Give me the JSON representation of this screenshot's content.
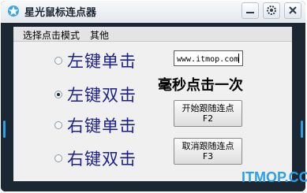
{
  "window": {
    "title": "星光鼠标连点器"
  },
  "titlebar_icons": {
    "app": "app-logo-icon",
    "minimize": "minimize-icon",
    "settings": "gear-icon",
    "close": "close-icon"
  },
  "menu": {
    "items": [
      "选择点击模式",
      "其他"
    ]
  },
  "modes": [
    {
      "label": "左键单击",
      "selected": false
    },
    {
      "label": "左键双击",
      "selected": true
    },
    {
      "label": "右键单击",
      "selected": false
    },
    {
      "label": "右键双击",
      "selected": false
    }
  ],
  "interval": {
    "value": "www.itmop.com",
    "label": "毫秒点击一次"
  },
  "buttons": {
    "start_label": "开始跟随连点",
    "start_hotkey": "F2",
    "cancel_label": "取消跟随连点",
    "cancel_hotkey": "F3"
  },
  "watermark": "ITMOP.COM",
  "colors": {
    "frame": "#1b2733",
    "accent": "#2ea0e6",
    "radio_text": "#1b1f8e"
  }
}
